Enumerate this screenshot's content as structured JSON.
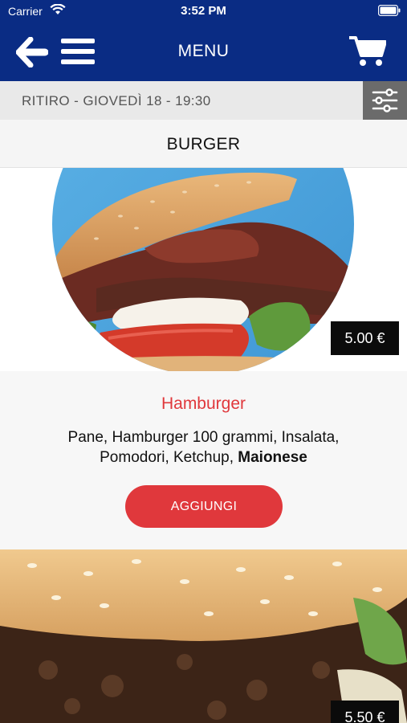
{
  "status_bar": {
    "carrier": "Carrier",
    "time": "3:52 PM"
  },
  "nav": {
    "title": "MENU",
    "back_icon": "arrow-left-icon",
    "menu_icon": "hamburger-menu-icon",
    "cart_icon": "shopping-cart-icon"
  },
  "pickup": {
    "text": "RITIRO - GIOVEDÌ 18 - 19:30",
    "filter_icon": "sliders-icon"
  },
  "category": {
    "name": "BURGER"
  },
  "products": [
    {
      "name": "Hamburger",
      "description_plain": "Pane, Hamburger 100 grammi, Insalata, Pomodori, Ketchup,",
      "description_bold": "Maionese",
      "price": "5.00 €",
      "add_label": "AGGIUNGI"
    },
    {
      "price": "5.50 €"
    }
  ],
  "colors": {
    "header_blue": "#0a2c84",
    "accent_red": "#e0383c",
    "price_tag": "#0b0b0b",
    "pickup_bg": "#e9e9e9",
    "filter_bg": "#6b6b6b"
  }
}
